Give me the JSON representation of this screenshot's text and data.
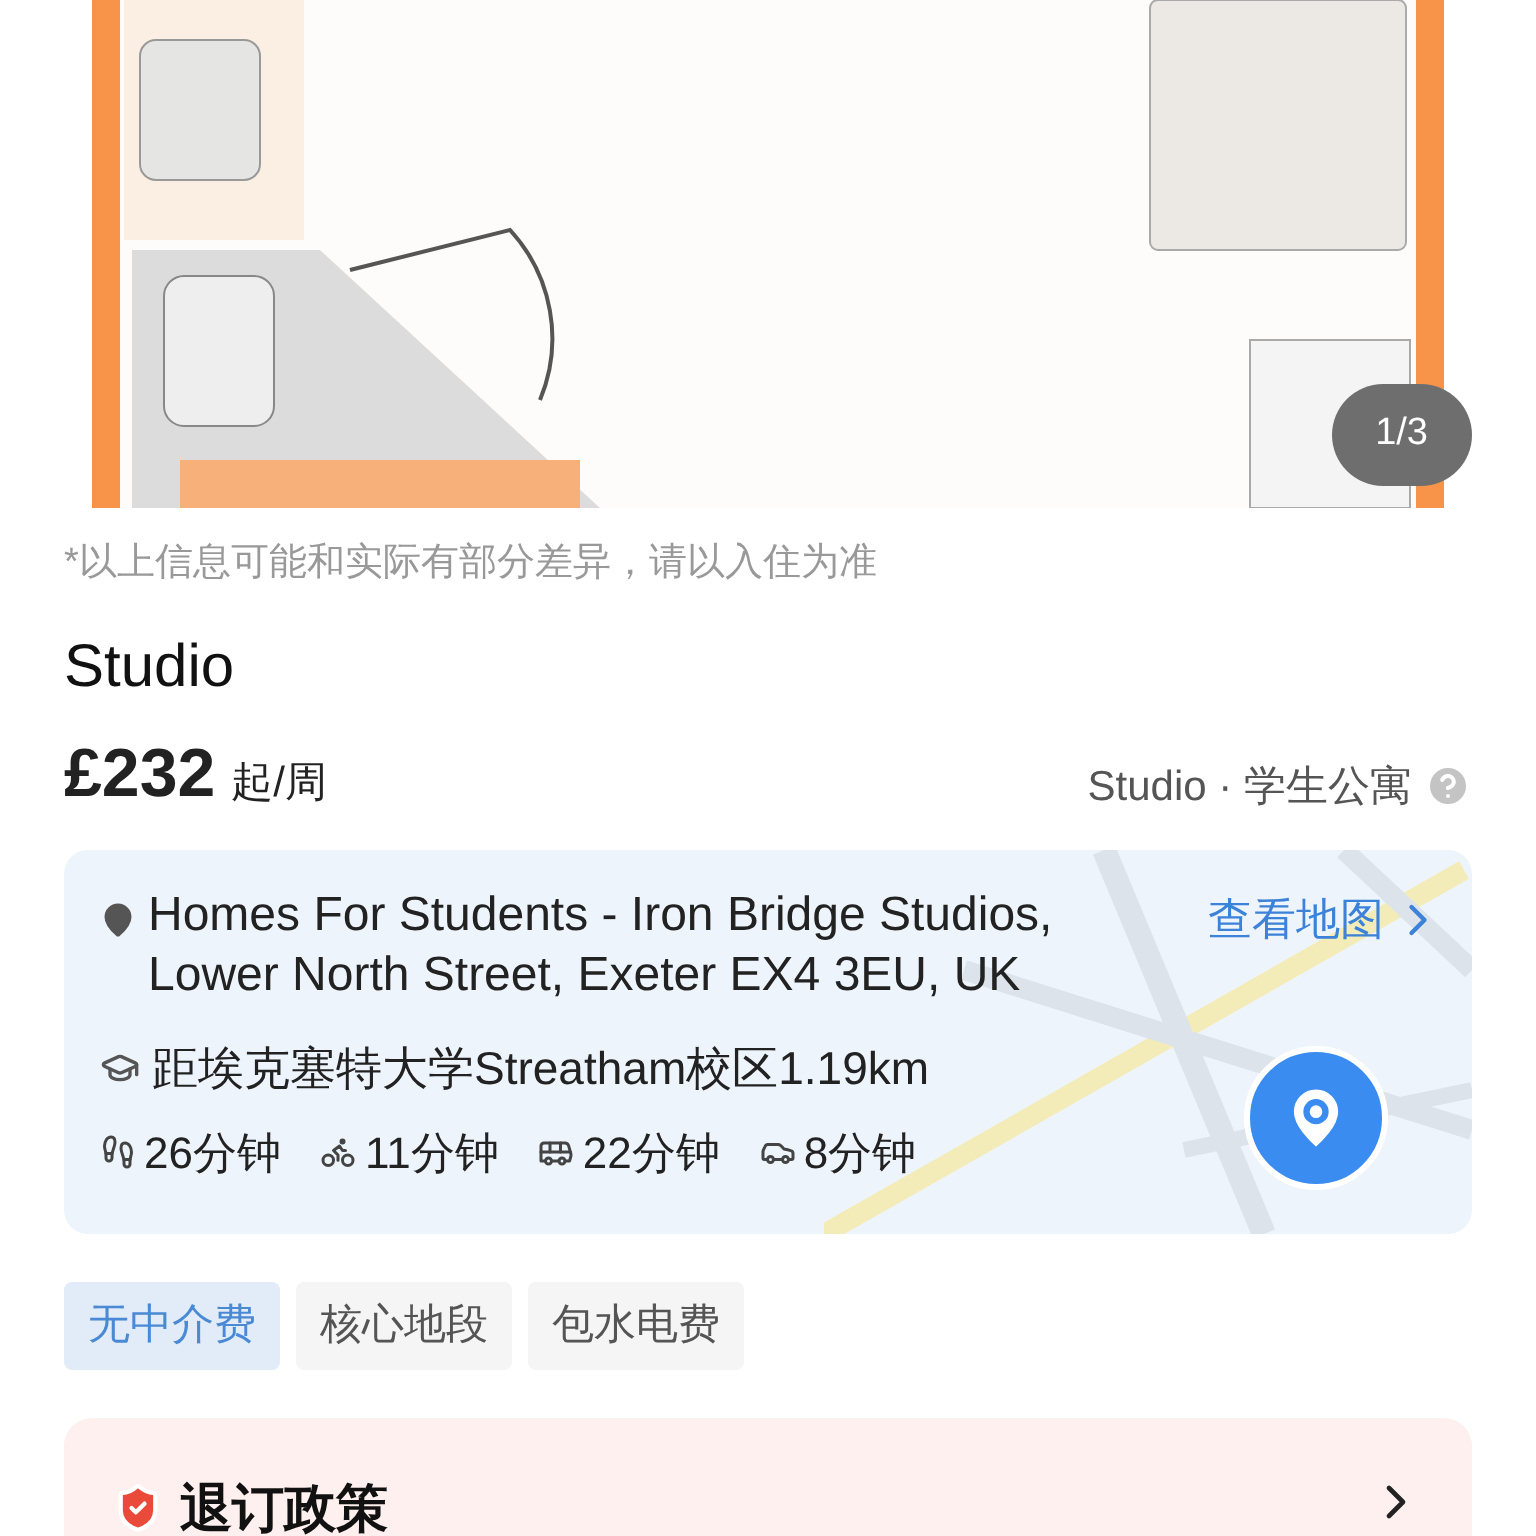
{
  "gallery": {
    "counter": "1/3"
  },
  "disclaimer": "*以上信息可能和实际有部分差异，请以入住为准",
  "title": "Studio",
  "price": {
    "amount": "£232",
    "unit": "起/周",
    "type": "Studio · 学生公寓"
  },
  "location": {
    "address": "Homes For Students - Iron Bridge Studios, Lower North Street, Exeter EX4 3EU, UK",
    "map_link": "查看地图",
    "distance": "距埃克塞特大学Streatham校区1.19km",
    "commutes": [
      {
        "kind": "walk",
        "time": "26分钟"
      },
      {
        "kind": "bike",
        "time": "11分钟"
      },
      {
        "kind": "bus",
        "time": "22分钟"
      },
      {
        "kind": "car",
        "time": "8分钟"
      }
    ]
  },
  "tags": [
    {
      "label": "无中介费",
      "highlighted": true
    },
    {
      "label": "核心地段",
      "highlighted": false
    },
    {
      "label": "包水电费",
      "highlighted": false
    }
  ],
  "policy": {
    "title": "退订政策"
  }
}
